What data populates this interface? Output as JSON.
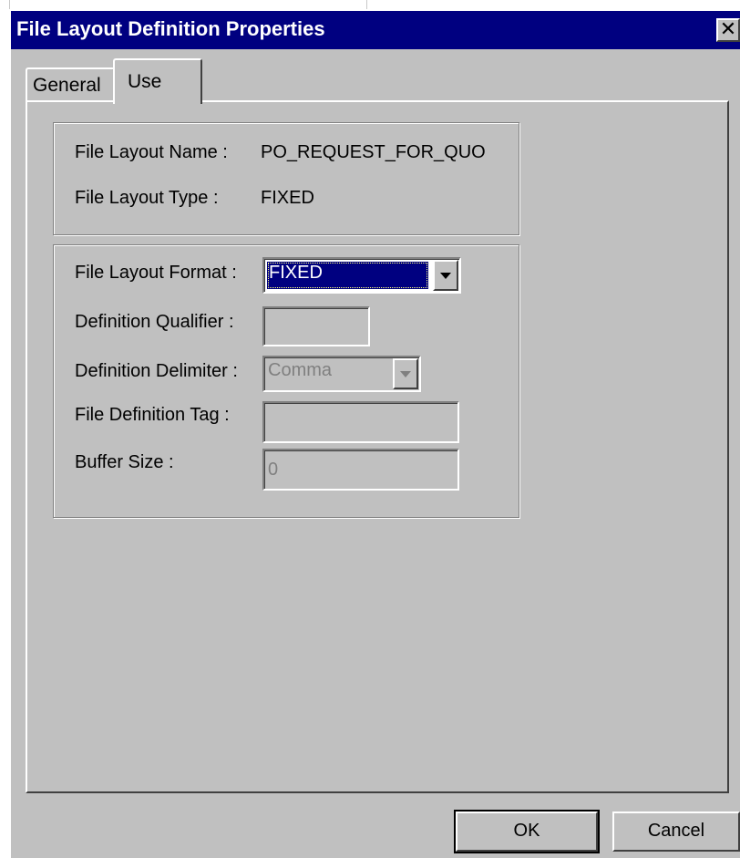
{
  "window": {
    "title": "File Layout Definition Properties",
    "close_glyph": "✕"
  },
  "tabs": [
    {
      "label": "General"
    },
    {
      "label": "Use"
    }
  ],
  "info": {
    "name_label": "File Layout Name :",
    "name_value": "PO_REQUEST_FOR_QUO",
    "type_label": "File Layout Type :",
    "type_value": "FIXED"
  },
  "fields": {
    "format_label": "File Layout Format :",
    "format_value": "FIXED",
    "qualifier_label": "Definition Qualifier :",
    "qualifier_value": "",
    "delimiter_label": "Definition Delimiter :",
    "delimiter_value": "Comma",
    "tag_label": "File Definition Tag :",
    "tag_value": "",
    "buffer_label": "Buffer Size :",
    "buffer_value": "0"
  },
  "buttons": {
    "ok": "OK",
    "cancel": "Cancel"
  },
  "colors": {
    "titlebar": "#000080",
    "face": "#c0c0c0",
    "selection": "#000080"
  }
}
